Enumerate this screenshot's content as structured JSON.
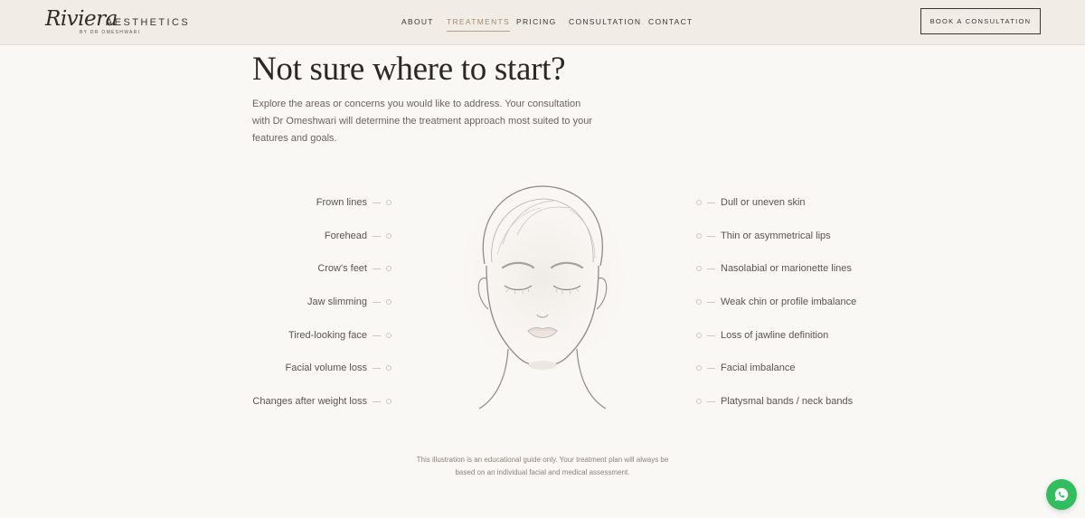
{
  "header": {
    "logo_script": "Riviera",
    "logo_word": "AESTHETICS",
    "logo_sub": "BY DR OMESHWARI",
    "nav": [
      "ABOUT",
      "TREATMENTS",
      "PRICING",
      "CONSULTATION",
      "CONTACT"
    ],
    "active_nav": "TREATMENTS",
    "book_button": "BOOK A CONSULTATION"
  },
  "main": {
    "title": "Not sure where to start?",
    "intro": "Explore the areas or concerns you would like to address. Your consultation with Dr Omeshwari will determine the treatment approach most suited to your features and goals.",
    "left_concerns": [
      "Frown lines",
      "Forehead",
      "Crow's feet",
      "Jaw slimming",
      "Tired-looking face",
      "Facial volume loss",
      "Changes after weight loss"
    ],
    "right_concerns": [
      "Dull or uneven skin",
      "Thin or asymmetrical lips",
      "Nasolabial or marionette lines",
      "Weak chin or profile imbalance",
      "Loss of jawline definition",
      "Facial imbalance",
      "Platysmal bands / neck bands"
    ],
    "disclaimer": "This illustration is an educational guide only. Your treatment plan will always be based on an individual facial and medical assessment."
  },
  "colors": {
    "background": "#faf8f5",
    "header": "#f1ece6",
    "accent": "#a88c6a",
    "whatsapp": "#2fbf5f"
  },
  "icons": {
    "whatsapp": "whatsapp-icon"
  }
}
